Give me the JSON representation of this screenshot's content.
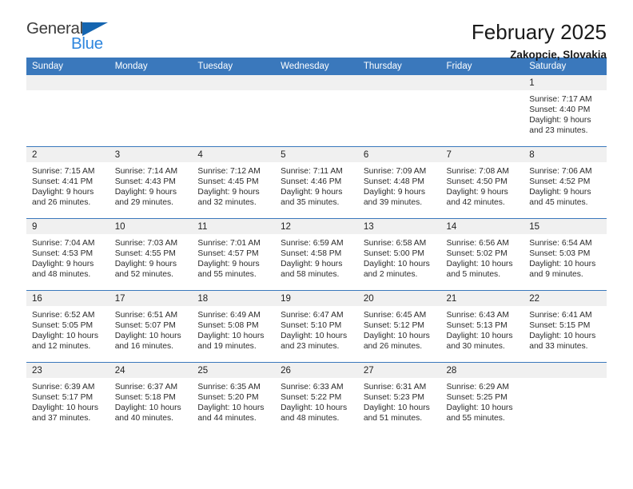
{
  "logo": {
    "text_primary": "General",
    "text_secondary": "Blue",
    "triangle_color": "#1565B0",
    "secondary_color": "#2E86DE"
  },
  "header": {
    "title": "February 2025",
    "subtitle": "Zakopcie, Slovakia"
  },
  "theme": {
    "header_blue": "#3A78BC",
    "band_gray": "#F0F0F0",
    "text_color": "#2B2B2B"
  },
  "calendar": {
    "weekday_headers": [
      "Sunday",
      "Monday",
      "Tuesday",
      "Wednesday",
      "Thursday",
      "Friday",
      "Saturday"
    ],
    "weeks": [
      [
        {
          "day": "",
          "sunrise": "",
          "sunset": "",
          "daylight": ""
        },
        {
          "day": "",
          "sunrise": "",
          "sunset": "",
          "daylight": ""
        },
        {
          "day": "",
          "sunrise": "",
          "sunset": "",
          "daylight": ""
        },
        {
          "day": "",
          "sunrise": "",
          "sunset": "",
          "daylight": ""
        },
        {
          "day": "",
          "sunrise": "",
          "sunset": "",
          "daylight": ""
        },
        {
          "day": "",
          "sunrise": "",
          "sunset": "",
          "daylight": ""
        },
        {
          "day": "1",
          "sunrise": "Sunrise: 7:17 AM",
          "sunset": "Sunset: 4:40 PM",
          "daylight": "Daylight: 9 hours and 23 minutes."
        }
      ],
      [
        {
          "day": "2",
          "sunrise": "Sunrise: 7:15 AM",
          "sunset": "Sunset: 4:41 PM",
          "daylight": "Daylight: 9 hours and 26 minutes."
        },
        {
          "day": "3",
          "sunrise": "Sunrise: 7:14 AM",
          "sunset": "Sunset: 4:43 PM",
          "daylight": "Daylight: 9 hours and 29 minutes."
        },
        {
          "day": "4",
          "sunrise": "Sunrise: 7:12 AM",
          "sunset": "Sunset: 4:45 PM",
          "daylight": "Daylight: 9 hours and 32 minutes."
        },
        {
          "day": "5",
          "sunrise": "Sunrise: 7:11 AM",
          "sunset": "Sunset: 4:46 PM",
          "daylight": "Daylight: 9 hours and 35 minutes."
        },
        {
          "day": "6",
          "sunrise": "Sunrise: 7:09 AM",
          "sunset": "Sunset: 4:48 PM",
          "daylight": "Daylight: 9 hours and 39 minutes."
        },
        {
          "day": "7",
          "sunrise": "Sunrise: 7:08 AM",
          "sunset": "Sunset: 4:50 PM",
          "daylight": "Daylight: 9 hours and 42 minutes."
        },
        {
          "day": "8",
          "sunrise": "Sunrise: 7:06 AM",
          "sunset": "Sunset: 4:52 PM",
          "daylight": "Daylight: 9 hours and 45 minutes."
        }
      ],
      [
        {
          "day": "9",
          "sunrise": "Sunrise: 7:04 AM",
          "sunset": "Sunset: 4:53 PM",
          "daylight": "Daylight: 9 hours and 48 minutes."
        },
        {
          "day": "10",
          "sunrise": "Sunrise: 7:03 AM",
          "sunset": "Sunset: 4:55 PM",
          "daylight": "Daylight: 9 hours and 52 minutes."
        },
        {
          "day": "11",
          "sunrise": "Sunrise: 7:01 AM",
          "sunset": "Sunset: 4:57 PM",
          "daylight": "Daylight: 9 hours and 55 minutes."
        },
        {
          "day": "12",
          "sunrise": "Sunrise: 6:59 AM",
          "sunset": "Sunset: 4:58 PM",
          "daylight": "Daylight: 9 hours and 58 minutes."
        },
        {
          "day": "13",
          "sunrise": "Sunrise: 6:58 AM",
          "sunset": "Sunset: 5:00 PM",
          "daylight": "Daylight: 10 hours and 2 minutes."
        },
        {
          "day": "14",
          "sunrise": "Sunrise: 6:56 AM",
          "sunset": "Sunset: 5:02 PM",
          "daylight": "Daylight: 10 hours and 5 minutes."
        },
        {
          "day": "15",
          "sunrise": "Sunrise: 6:54 AM",
          "sunset": "Sunset: 5:03 PM",
          "daylight": "Daylight: 10 hours and 9 minutes."
        }
      ],
      [
        {
          "day": "16",
          "sunrise": "Sunrise: 6:52 AM",
          "sunset": "Sunset: 5:05 PM",
          "daylight": "Daylight: 10 hours and 12 minutes."
        },
        {
          "day": "17",
          "sunrise": "Sunrise: 6:51 AM",
          "sunset": "Sunset: 5:07 PM",
          "daylight": "Daylight: 10 hours and 16 minutes."
        },
        {
          "day": "18",
          "sunrise": "Sunrise: 6:49 AM",
          "sunset": "Sunset: 5:08 PM",
          "daylight": "Daylight: 10 hours and 19 minutes."
        },
        {
          "day": "19",
          "sunrise": "Sunrise: 6:47 AM",
          "sunset": "Sunset: 5:10 PM",
          "daylight": "Daylight: 10 hours and 23 minutes."
        },
        {
          "day": "20",
          "sunrise": "Sunrise: 6:45 AM",
          "sunset": "Sunset: 5:12 PM",
          "daylight": "Daylight: 10 hours and 26 minutes."
        },
        {
          "day": "21",
          "sunrise": "Sunrise: 6:43 AM",
          "sunset": "Sunset: 5:13 PM",
          "daylight": "Daylight: 10 hours and 30 minutes."
        },
        {
          "day": "22",
          "sunrise": "Sunrise: 6:41 AM",
          "sunset": "Sunset: 5:15 PM",
          "daylight": "Daylight: 10 hours and 33 minutes."
        }
      ],
      [
        {
          "day": "23",
          "sunrise": "Sunrise: 6:39 AM",
          "sunset": "Sunset: 5:17 PM",
          "daylight": "Daylight: 10 hours and 37 minutes."
        },
        {
          "day": "24",
          "sunrise": "Sunrise: 6:37 AM",
          "sunset": "Sunset: 5:18 PM",
          "daylight": "Daylight: 10 hours and 40 minutes."
        },
        {
          "day": "25",
          "sunrise": "Sunrise: 6:35 AM",
          "sunset": "Sunset: 5:20 PM",
          "daylight": "Daylight: 10 hours and 44 minutes."
        },
        {
          "day": "26",
          "sunrise": "Sunrise: 6:33 AM",
          "sunset": "Sunset: 5:22 PM",
          "daylight": "Daylight: 10 hours and 48 minutes."
        },
        {
          "day": "27",
          "sunrise": "Sunrise: 6:31 AM",
          "sunset": "Sunset: 5:23 PM",
          "daylight": "Daylight: 10 hours and 51 minutes."
        },
        {
          "day": "28",
          "sunrise": "Sunrise: 6:29 AM",
          "sunset": "Sunset: 5:25 PM",
          "daylight": "Daylight: 10 hours and 55 minutes."
        },
        {
          "day": "",
          "sunrise": "",
          "sunset": "",
          "daylight": ""
        }
      ]
    ]
  }
}
